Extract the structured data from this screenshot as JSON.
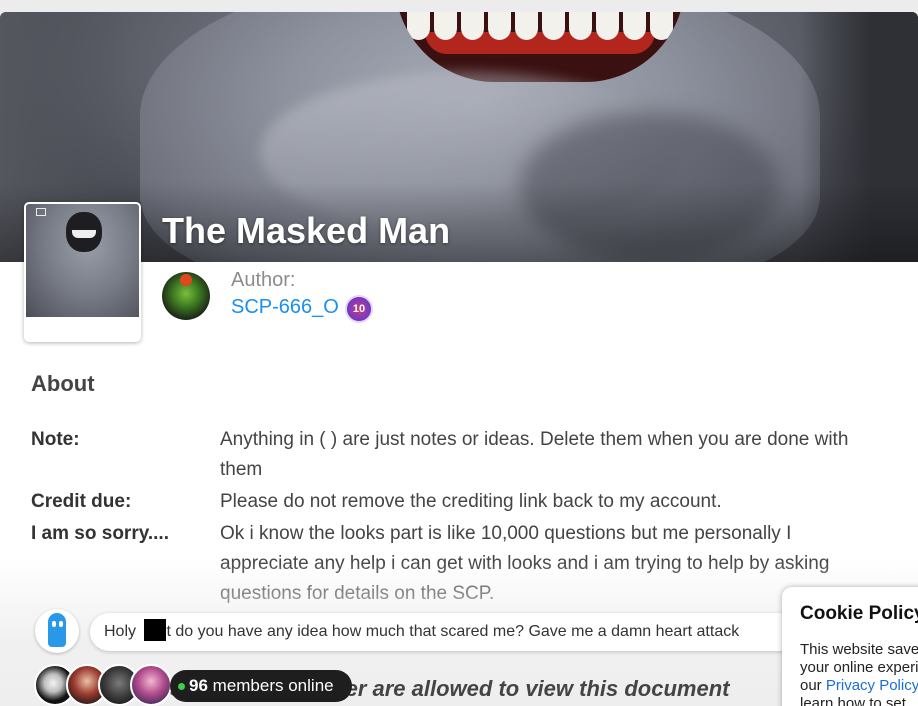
{
  "page": {
    "title": "The Masked Man"
  },
  "author": {
    "label": "Author:",
    "name": "SCP-666_O",
    "level": "10"
  },
  "about": {
    "heading": "About",
    "fields": [
      {
        "label": "Note:",
        "value": "Anything in ( ) are just notes or ideas. Delete them when you are done with them"
      },
      {
        "label": "Credit due:",
        "value": "Please do not remove the crediting link back to my account."
      },
      {
        "label": "I am so sorry....",
        "value": "Ok i know the looks part is like 10,000 questions but me personally I appreciate any help i can get with looks and i am trying to help by asking questions for details on the SCP."
      }
    ]
  },
  "restricted_notice": "members and higher are allowed to view this document",
  "chat": {
    "message_before": "Holy ",
    "message_after": "t do you have any idea how much that scared me? Gave me a damn heart attack"
  },
  "members_online": {
    "count": "96",
    "label": "members online"
  },
  "cookie": {
    "title": "Cookie Policy",
    "line1": "This website saves cookies to your browser in order to improve",
    "line2": "your online experience and show you personalized content. Read",
    "line3_prefix": "our ",
    "link": "Privacy Policy",
    "line4": "learn how to set"
  },
  "colors": {
    "link": "#1b8ff0",
    "online_dot": "#3ad04a"
  }
}
